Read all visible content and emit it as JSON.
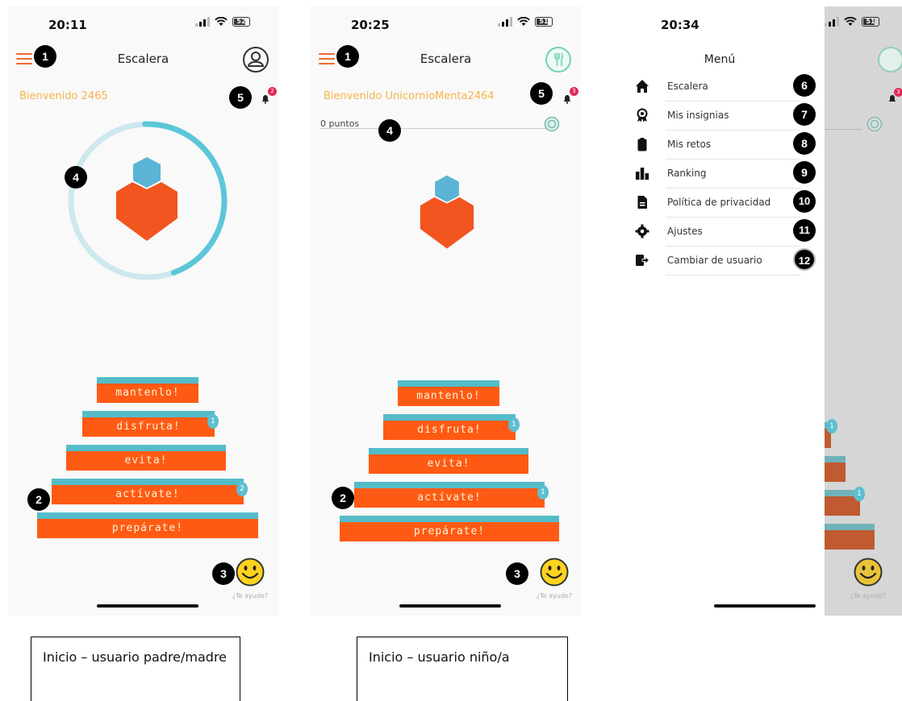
{
  "screen1": {
    "time": "20:11",
    "battery": "52",
    "title": "Escalera",
    "welcome": "Bienvenido 2465",
    "notification_count": "2",
    "steps": [
      {
        "label": "mantenlo!",
        "badge": ""
      },
      {
        "label": "disfruta!",
        "badge": "1"
      },
      {
        "label": "evita!",
        "badge": ""
      },
      {
        "label": "actívate!",
        "badge": "2"
      },
      {
        "label": "prepárate!",
        "badge": ""
      }
    ],
    "progress_ring_fraction": 0.45,
    "help_label": "¿Te ayudo?"
  },
  "screen2": {
    "time": "20:25",
    "battery": "51",
    "title": "Escalera",
    "welcome": "Bienvenido UnicornioMenta2464",
    "notification_count": "3",
    "points": "0 puntos",
    "steps": [
      {
        "label": "mantenlo!",
        "badge": ""
      },
      {
        "label": "disfruta!",
        "badge": "1"
      },
      {
        "label": "evita!",
        "badge": ""
      },
      {
        "label": "actívate!",
        "badge": "1"
      },
      {
        "label": "prepárate!",
        "badge": ""
      }
    ],
    "help_label": "¿Te ayudo?"
  },
  "screen3": {
    "time": "20:34",
    "battery": "51",
    "menu_title": "Menú",
    "menu_items": [
      {
        "label": "Escalera",
        "icon": "home-icon",
        "marker": "6"
      },
      {
        "label": "Mis insignias",
        "icon": "medal-icon",
        "marker": "7"
      },
      {
        "label": "Mis retos",
        "icon": "clipboard-icon",
        "marker": "8"
      },
      {
        "label": "Ranking",
        "icon": "ranking-icon",
        "marker": "9"
      },
      {
        "label": "Política de privacidad",
        "icon": "document-icon",
        "marker": "10"
      },
      {
        "label": "Ajustes",
        "icon": "gear-icon",
        "marker": "11"
      },
      {
        "label": "Cambiar de usuario",
        "icon": "logout-icon",
        "marker": "12"
      }
    ],
    "help_label": "¿Te ayudo?",
    "notification_count": "3",
    "step_badges": [
      "1",
      "1"
    ]
  },
  "markers": {
    "menu": "1",
    "steps": "2",
    "help": "3",
    "progress": "4",
    "notifications": "5"
  },
  "captions": {
    "parent": "Inicio – usuario padre/madre",
    "child": "Inicio – usuario niño/a"
  },
  "colors": {
    "accent_orange": "#ff5a14",
    "teal": "#54bcc8",
    "hexagon_blue": "#5ab4d4",
    "heart_orange": "#f2551f",
    "welcome_yellow": "#f6b44a",
    "badge_red": "#e02a58"
  }
}
